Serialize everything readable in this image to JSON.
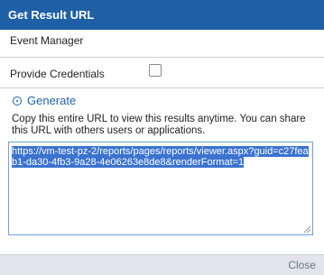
{
  "dialog": {
    "title": "Get Result URL",
    "event_manager": "Event Manager",
    "provide_credentials": "Provide Credentials",
    "generate_label": "Generate",
    "generate_icon": "generate-icon",
    "copy_text": "Copy this entire URL to view this results anytime. You can share this URL with others users or applications.",
    "url_value": "https://vm-test-pz-2/reports/pages/reports/viewer.aspx?guid=c27feab1-da30-4fb3-9a28-4e06263e8de8&renderFormat=1",
    "close_label": "Close"
  },
  "colors": {
    "titlebar": "#1e5fa6",
    "link": "#1e63ad",
    "selection": "#3b73cf",
    "footer": "#e1e5ea"
  }
}
